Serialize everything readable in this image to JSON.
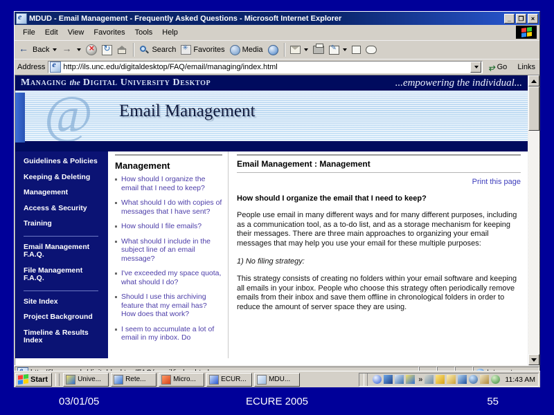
{
  "slide": {
    "footer": {
      "date": "03/01/05",
      "center": "ECURE 2005",
      "number": "55"
    }
  },
  "browser": {
    "title": "MDUD - Email Management - Frequently Asked Questions - Microsoft Internet Explorer",
    "window_buttons": {
      "minimize": "_",
      "restore": "❐",
      "close": "×"
    },
    "menu": [
      "File",
      "Edit",
      "View",
      "Favorites",
      "Tools",
      "Help"
    ],
    "toolbar": {
      "back": "Back",
      "search": "Search",
      "favorites": "Favorites",
      "media": "Media"
    },
    "address": {
      "label": "Address",
      "url": "http://ils.unc.edu/digitaldesktop/FAQ/email/managing/index.html",
      "go": "Go",
      "links": "Links"
    },
    "status": {
      "url": "http://ils.unc.edu/digitaldesktop/FAQ/email/index.html",
      "zone": "Internet"
    }
  },
  "taskbar": {
    "start": "Start",
    "buttons": [
      {
        "label": "Unive..."
      },
      {
        "label": "Rete..."
      },
      {
        "label": "Micro..."
      },
      {
        "label": "ECUR..."
      },
      {
        "label": "MDU..."
      }
    ],
    "overflow": "»",
    "clock": "11:43 AM"
  },
  "page": {
    "banner": {
      "brand_pre": "Managing",
      "brand_the": "the",
      "brand_post": "Digital University Desktop",
      "tagline": "...empowering the individual...",
      "heading": "Email Management",
      "at_glyph": "@"
    },
    "nav": {
      "group1": [
        "Guidelines & Policies",
        "Keeping & Deleting",
        "Management",
        "Access & Security",
        "Training"
      ],
      "group2": [
        "Email Management F.A.Q.",
        "File Management F.A.Q."
      ],
      "group3": [
        "Site Index",
        "Project Background",
        "Timeline & Results Index"
      ]
    },
    "questions": {
      "title": "Management",
      "items": [
        "How should I organize the email that I need to keep?",
        "What should I do with copies of messages that I have sent?",
        "How should I file emails?",
        "What should I include in the subject line of an email message?",
        "I've exceeded my space quota, what should I do?",
        "Should I use this archiving feature that my email has? How does that work?",
        "I seem to accumulate a lot of email in my inbox. Do"
      ]
    },
    "main": {
      "breadcrumb": "Email Management : Management",
      "print_link": "Print this page",
      "question": "How should I organize the email that I need to keep?",
      "paragraph1": "People use email in many different ways and for many different purposes, including as a communication tool, as a to-do list, and as a storage mechanism for keeping their messages. There are three main approaches to organizing your email messages that may help you use your email for these multiple purposes:",
      "strategy_heading": "1) No filing strategy:",
      "paragraph2": "This strategy consists of creating no folders within your email software and keeping all emails in your inbox. People who choose this strategy often periodically remove emails from their inbox and save them offline in chronological folders in order to reduce the amount of server space they are using."
    }
  },
  "colors": {
    "slide_bg": "#000099",
    "navy": "#000b5e",
    "nav_bg": "#0b1374",
    "link": "#4b3ca8",
    "titlebar": "#0a246a"
  }
}
